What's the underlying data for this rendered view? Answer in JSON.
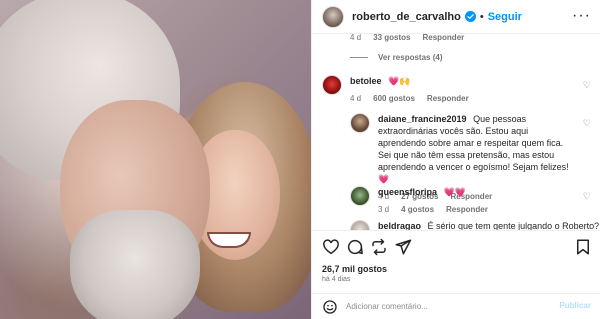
{
  "post": {
    "username": "roberto_de_carvalho",
    "separator": "•",
    "follow_label": "Seguir",
    "more_label": "···"
  },
  "comments_prev": {
    "age": "4 d",
    "likes": "33 gostos",
    "reply": "Responder",
    "view_replies": "Ver respostas (4)"
  },
  "comments": [
    {
      "username": "betolee",
      "text": "💗🙌",
      "age": "4 d",
      "likes": "600 gostos",
      "reply": "Responder"
    },
    {
      "username": "daiane_francine2019",
      "text": "Que pessoas extraordinárias vocês são. Estou aqui aprendendo sobre amar e respeitar quem fica. Sei que não têm essa pretensão, mas estou aprendendo a vencer o egoísmo! Sejam felizes! 💗",
      "age": "4 d",
      "likes": "27 gostos",
      "reply": "Responder"
    },
    {
      "username": "queensfloripa",
      "text": "💗💗",
      "age": "3 d",
      "likes": "4 gostos",
      "reply": "Responder"
    },
    {
      "username": "beldragao",
      "text": "É sério que tem gente julgando o Roberto?"
    }
  ],
  "actions": {
    "likes_count": "26,7 mil gostos",
    "timestamp": "há 4 dias",
    "comment_placeholder": "Adicionar comentário...",
    "publish_label": "Publicar"
  },
  "colors": {
    "accent": "#0095f6",
    "publish_disabled": "#b2dffc",
    "muted": "#737373",
    "heart": "#e60023"
  }
}
